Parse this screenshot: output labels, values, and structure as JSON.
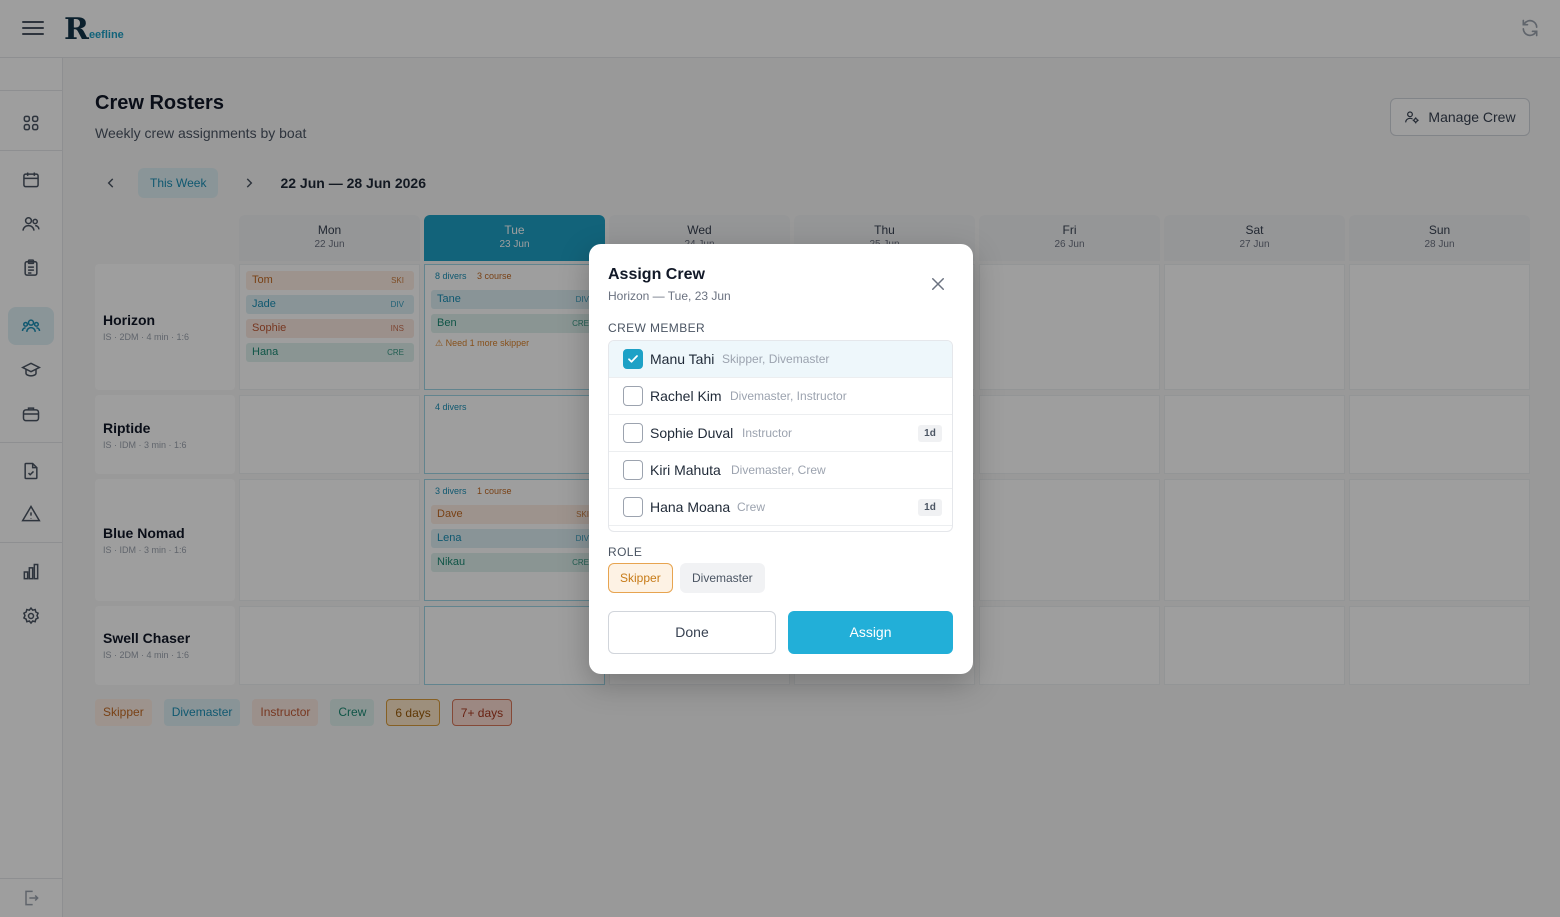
{
  "app": {
    "logo_initial": "R",
    "logo_rest": "eefline"
  },
  "page": {
    "title": "Crew Rosters",
    "subtitle": "Weekly crew assignments by boat",
    "manage_crew_label": "Manage Crew"
  },
  "week": {
    "this_week_label": "This Week",
    "range": "22 Jun — 28 Jun 2026"
  },
  "days": [
    {
      "name": "Mon",
      "date": "22 Jun"
    },
    {
      "name": "Tue",
      "date": "23 Jun",
      "today": true
    },
    {
      "name": "Wed",
      "date": "24 Jun"
    },
    {
      "name": "Thu",
      "date": "25 Jun"
    },
    {
      "name": "Fri",
      "date": "26 Jun"
    },
    {
      "name": "Sat",
      "date": "27 Jun"
    },
    {
      "name": "Sun",
      "date": "28 Jun"
    }
  ],
  "boats": [
    {
      "name": "Horizon",
      "meta": "IS · 2DM · 4 min · 1:6",
      "mon": [
        {
          "name": "Tom",
          "tag": "SKI",
          "role": "skipper"
        },
        {
          "name": "Jade",
          "tag": "DIV",
          "role": "dm"
        },
        {
          "name": "Sophie",
          "tag": "INS",
          "role": "inst"
        },
        {
          "name": "Hana",
          "tag": "CRE",
          "role": "crew"
        }
      ],
      "tue": {
        "divers": "8 divers",
        "course": "3 course",
        "chips": [
          {
            "name": "Tane",
            "tag": "DIV",
            "role": "dm"
          },
          {
            "name": "Ben",
            "tag": "CRE",
            "role": "crew"
          }
        ],
        "warning": "⚠ Need 1 more skipper"
      }
    },
    {
      "name": "Riptide",
      "meta": "IS · IDM · 3 min · 1:6",
      "tue": {
        "divers": "4 divers"
      }
    },
    {
      "name": "Blue Nomad",
      "meta": "IS · IDM · 3 min · 1:6",
      "tue": {
        "divers": "3 divers",
        "course": "1 course",
        "chips": [
          {
            "name": "Dave",
            "tag": "SKI",
            "role": "skipper"
          },
          {
            "name": "Lena",
            "tag": "DIV",
            "role": "dm"
          },
          {
            "name": "Nikau",
            "tag": "CRE",
            "role": "crew"
          }
        ]
      }
    },
    {
      "name": "Swell Chaser",
      "meta": "IS · 2DM · 4 min · 1:6"
    }
  ],
  "legend": [
    "Skipper",
    "Divemaster",
    "Instructor",
    "Crew",
    "6 days",
    "7+ days"
  ],
  "modal": {
    "title": "Assign Crew",
    "subtitle": "Horizon — Tue, 23 Jun",
    "crew_member_label": "CREW MEMBER",
    "members": [
      {
        "name": "Manu Tahi",
        "roles": "Skipper, Divemaster",
        "checked": true,
        "badge": ""
      },
      {
        "name": "Rachel Kim",
        "roles": "Divemaster, Instructor",
        "checked": false,
        "badge": ""
      },
      {
        "name": "Sophie Duval",
        "roles": "Instructor",
        "checked": false,
        "badge": "1d"
      },
      {
        "name": "Kiri Mahuta",
        "roles": "Divemaster, Crew",
        "checked": false,
        "badge": ""
      },
      {
        "name": "Hana Moana",
        "roles": "Crew",
        "checked": false,
        "badge": "1d"
      }
    ],
    "role_label": "ROLE",
    "roles": [
      "Skipper",
      "Divemaster"
    ],
    "selected_role": "Skipper",
    "done_label": "Done",
    "assign_label": "Assign"
  },
  "colors": {
    "accent": "#1da1c6",
    "skipper": "#c36a23",
    "divemaster": "#1a8fb5",
    "instructor": "#c05a36",
    "crew": "#1b8a73"
  }
}
